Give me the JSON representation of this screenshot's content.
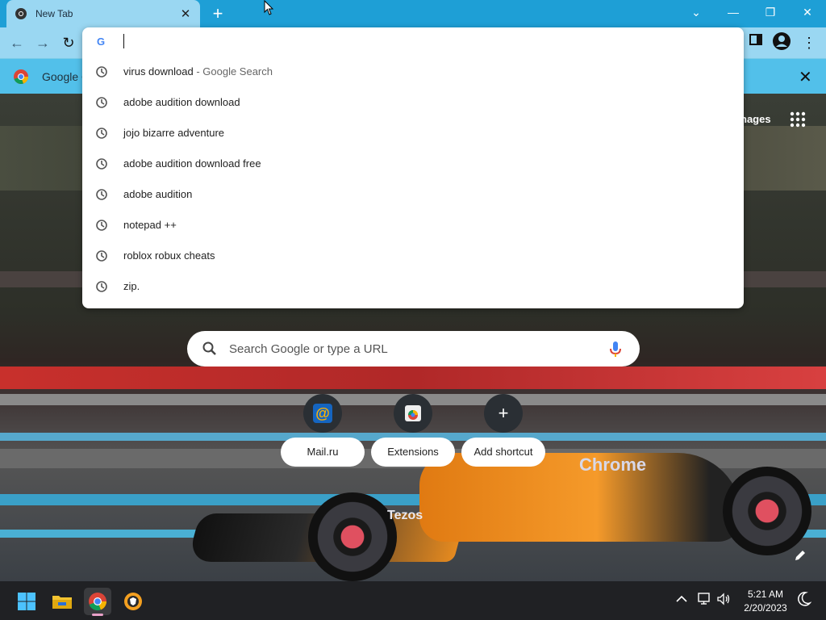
{
  "tab": {
    "title": "New Tab",
    "close": "✕",
    "new_tab": "+"
  },
  "window_controls": {
    "tab_search": "⌄",
    "minimize": "—",
    "restore": "❐",
    "close": "✕"
  },
  "toolbar": {
    "back": "←",
    "forward": "→",
    "reload": "↻",
    "menu": "⋮"
  },
  "infobar": {
    "text": "Google C",
    "close": "✕"
  },
  "header_links": {
    "images": "nages"
  },
  "omnibox": {
    "input_value": "",
    "suggestions": [
      {
        "text": "virus download",
        "suffix": " - Google Search"
      },
      {
        "text": "adobe audition download",
        "suffix": ""
      },
      {
        "text": "jojo bizarre adventure",
        "suffix": ""
      },
      {
        "text": "adobe audition download free",
        "suffix": ""
      },
      {
        "text": "adobe audition",
        "suffix": ""
      },
      {
        "text": "notepad ++",
        "suffix": ""
      },
      {
        "text": "roblox robux cheats",
        "suffix": ""
      },
      {
        "text": "zip.",
        "suffix": ""
      }
    ]
  },
  "search": {
    "placeholder": "Search Google or type a URL"
  },
  "shortcuts": [
    {
      "label": "Mail.ru",
      "icon": "mailru-icon",
      "glyph": "@"
    },
    {
      "label": "Extensions",
      "icon": "extensions-icon",
      "glyph": ""
    },
    {
      "label": "Add shortcut",
      "icon": "plus-icon",
      "glyph": "+"
    }
  ],
  "car": {
    "logo": "Chrome",
    "sponsor": "Tezos"
  },
  "taskbar": {
    "time": "5:21 AM",
    "date": "2/20/2023",
    "tray_chevron": "^"
  },
  "colors": {
    "titlebar": "#1e9fd6",
    "toolbar": "#9ad7f2",
    "infobar": "#52c0ea",
    "taskbar": "#202124",
    "google_blue": "#4285f4"
  }
}
